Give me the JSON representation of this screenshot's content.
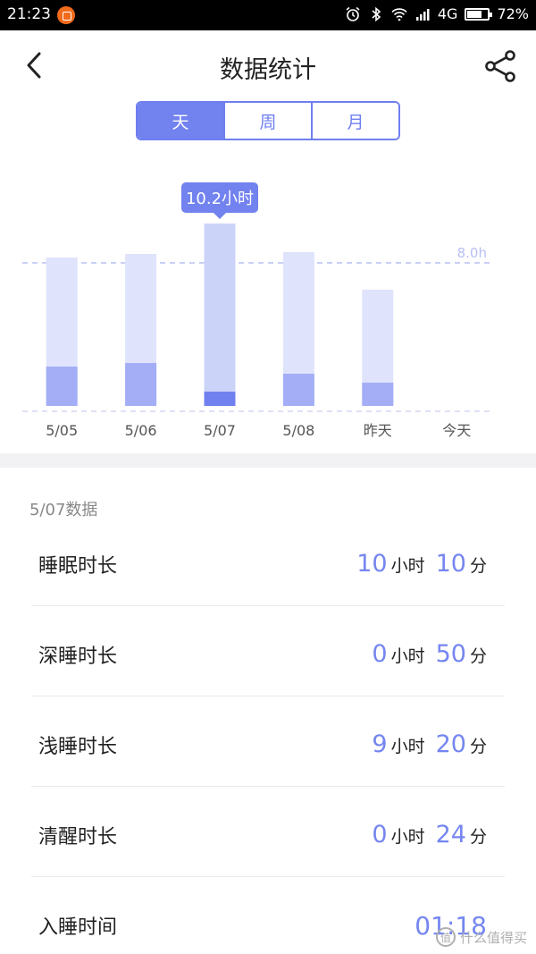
{
  "status_bar": {
    "time": "21:23",
    "network": "4G",
    "battery_percent": "72%",
    "battery_level": 0.72
  },
  "header": {
    "title": "数据统计",
    "back_icon": "chevron-left-icon",
    "share_icon": "share-icon"
  },
  "tabs": [
    {
      "label": "天",
      "active": true
    },
    {
      "label": "周",
      "active": false
    },
    {
      "label": "月",
      "active": false
    }
  ],
  "chart_data": {
    "type": "bar",
    "categories": [
      "5/05",
      "5/06",
      "5/07",
      "5/08",
      "昨天",
      "今天"
    ],
    "series": [
      {
        "values": [
          8.3,
          8.5,
          10.2,
          8.6,
          6.5,
          0
        ]
      },
      {
        "values": [
          2.2,
          2.4,
          0.8,
          1.8,
          1.3,
          0
        ]
      }
    ],
    "reference_line": {
      "value": 8.0,
      "label": "8.0h"
    },
    "tooltip": {
      "category": "5/07",
      "label": "10.2小时"
    },
    "ylim": [
      0,
      12
    ],
    "colors": {
      "total": "#dfe3fb",
      "total_selected": "#ccd3f8",
      "deep": "#a3aef6",
      "deep_selected": "#7081ef",
      "tooltip": "#7282ef",
      "refline": "#b8bff2"
    }
  },
  "details": {
    "title": "5/07数据",
    "rows": [
      {
        "label": "睡眠时长",
        "hours": "10",
        "hour_unit": "小时",
        "minutes": "10",
        "minute_unit": "分"
      },
      {
        "label": "深睡时长",
        "hours": "0",
        "hour_unit": "小时",
        "minutes": "50",
        "minute_unit": "分"
      },
      {
        "label": "浅睡时长",
        "hours": "9",
        "hour_unit": "小时",
        "minutes": "20",
        "minute_unit": "分"
      },
      {
        "label": "清醒时长",
        "hours": "0",
        "hour_unit": "小时",
        "minutes": "24",
        "minute_unit": "分"
      }
    ],
    "sleep_time": {
      "label": "入睡时间",
      "value": "01:18"
    }
  },
  "watermark": {
    "text": "什么值得买",
    "logo": "值"
  }
}
